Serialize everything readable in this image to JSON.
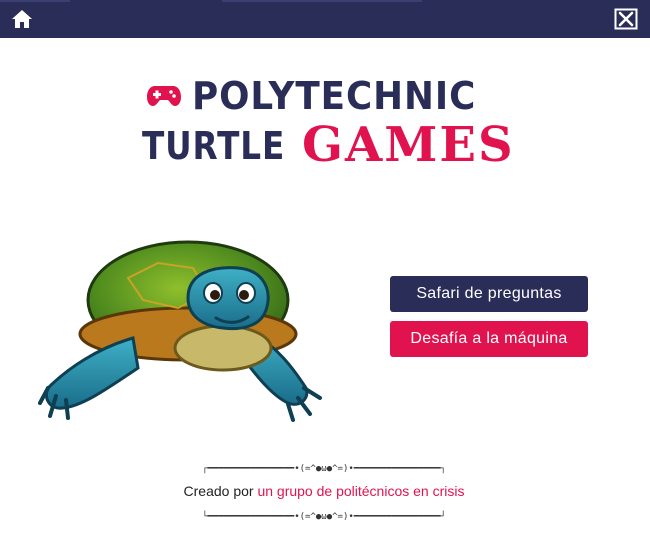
{
  "topbar": {
    "home_icon": "home-icon",
    "close_icon": "close-icon"
  },
  "logo": {
    "gamepad_icon": "gamepad-icon",
    "line1": "POLYTECHNIC",
    "line2_word1": "TURTLE",
    "line2_word2": "GAMES"
  },
  "hero_image": "turtle-illustration",
  "menu": {
    "safari_label": "Safari de preguntas",
    "desafia_label": "Desafía a la máquina"
  },
  "credit": {
    "rule_text": "┌━━━━━━━━━━━━━━━━•(=^●ω●^=)•━━━━━━━━━━━━━━━━┐",
    "rule_text_bottom": "└━━━━━━━━━━━━━━━━•(=^●ω●^=)•━━━━━━━━━━━━━━━━┘",
    "prefix": "Creado por ",
    "highlight": "un grupo de politécnicos en crisis"
  },
  "colors": {
    "navy": "#2a2d57",
    "accent": "#e0134e",
    "background": "#ffffff"
  }
}
